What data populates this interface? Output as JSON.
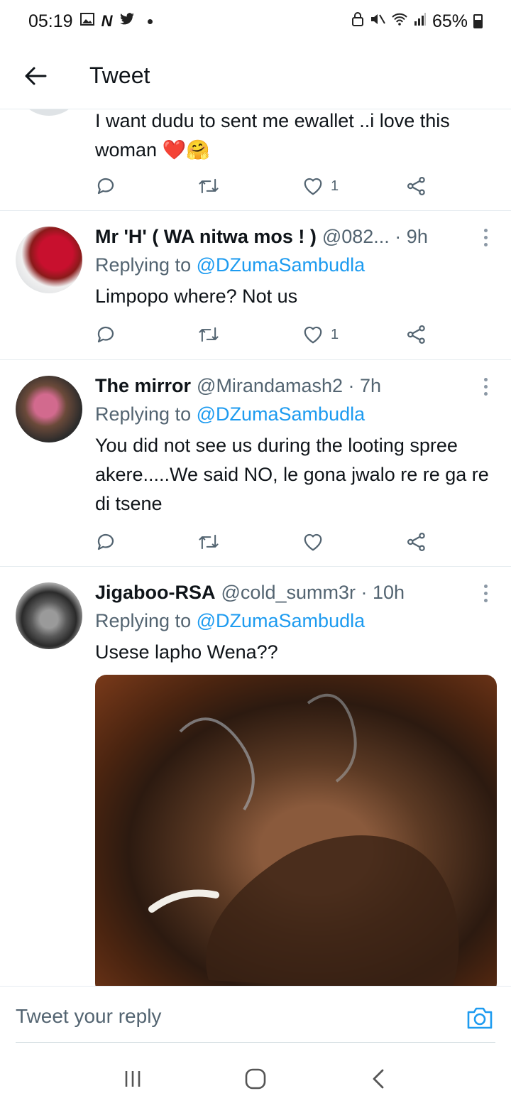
{
  "status_bar": {
    "time": "05:19",
    "battery": "65%"
  },
  "header": {
    "title": "Tweet"
  },
  "tweets": [
    {
      "text": "I want dudu to sent  me ewallet ..i love this woman ❤️🤗",
      "likes": "1"
    },
    {
      "author": "Mr 'H' ( WA nitwa mos ! )",
      "handle": "@082... · 9h",
      "replying_label": "Replying to",
      "replying_to": "@DZumaSambudla",
      "text": "Limpopo where? Not us",
      "likes": "1"
    },
    {
      "author": "The mirror",
      "handle": "@Mirandamash2 · 7h",
      "replying_label": "Replying to",
      "replying_to": "@DZumaSambudla",
      "text": "You did not see us during the looting spree akere.....We said NO, le gona jwalo re re ga re di tsene",
      "likes": ""
    },
    {
      "author": "Jigaboo-RSA",
      "handle": "@cold_summ3r · 10h",
      "replying_label": "Replying to",
      "replying_to": "@DZumaSambudla",
      "text": "Usese lapho Wena??"
    }
  ],
  "reply_bar": {
    "placeholder": "Tweet your reply"
  },
  "colors": {
    "accent": "#1d9bf0",
    "secondary_text": "#536471",
    "primary_text": "#0f1419"
  }
}
